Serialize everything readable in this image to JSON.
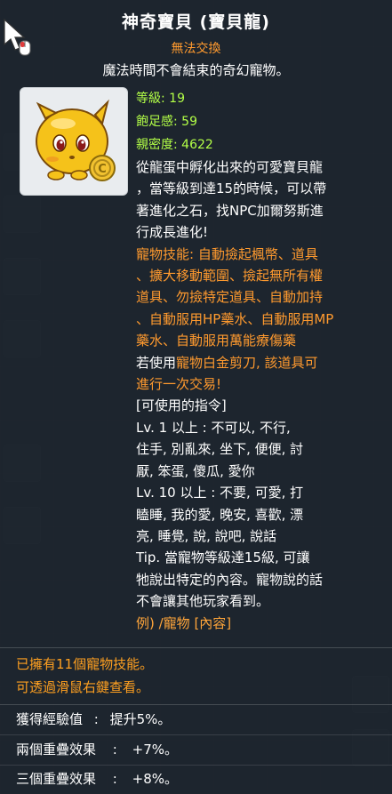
{
  "item": {
    "title": "神奇寶貝 (寶貝龍)",
    "tradable": "無法交換",
    "description": "魔法時間不會結束的奇幻寵物。"
  },
  "stats": {
    "level": "等級: 19",
    "satiety": "飽足感: 59",
    "closeness": "親密度: 4622"
  },
  "body": {
    "lines_white_1": [
      "從龍蛋中孵化出來的可愛寶貝龍",
      "，當等級到達15的時候，可以帶",
      "著進化之石，找NPC加爾努斯進",
      "行成長進化!"
    ],
    "skills_lines": [
      "寵物技能: 自動撿起楓幣、道具",
      "、擴大移動範圍、撿起無所有權",
      "道具、勿撿特定道具、自動加持",
      "、自動服用HP藥水、自動服用MP",
      "藥水、自動服用萬能療傷藥"
    ],
    "trade_line_1_a": "若使用",
    "trade_line_1_b": "寵物白金剪刀, 該道具可",
    "trade_line_2": "進行一次交易!",
    "commands_header": "[可使用的指令]",
    "commands_lines": [
      "Lv. 1 以上 : 不可以, 不行,",
      "住手, 別亂來, 坐下, 便便, 討",
      "厭, 笨蛋, 傻瓜, 愛你",
      "Lv. 10 以上 : 不要, 可愛, 打",
      "瞌睡, 我的愛, 晚安, 喜歡, 漂",
      "亮, 睡覺, 說, 說吧, 說話",
      "Tip. 當寵物等級達15級, 可讓",
      "牠說出特定的內容。寵物說的話",
      "不會讓其他玩家看到。"
    ],
    "example_line": "例) /寵物 [內容]"
  },
  "footer": {
    "owned_line_1": "已擁有11個寵物技能。",
    "owned_line_2": "可透過滑鼠右鍵查看。",
    "rows": [
      {
        "label": "獲得經驗值",
        "sep": ":",
        "value": "提升5%。"
      },
      {
        "label": "兩個重疊效果",
        "sep": ":",
        "value": "+7%。"
      },
      {
        "label": "三個重疊效果",
        "sep": ":",
        "value": "+8%。"
      }
    ]
  },
  "colors": {
    "stat_green": "#b3ff47",
    "orange": "#ff9a2e",
    "white": "#ffffff",
    "pet_yellow": "#f5c21a"
  },
  "icons": [
    "mouse-cursor-icon",
    "dragon-pet-icon"
  ]
}
